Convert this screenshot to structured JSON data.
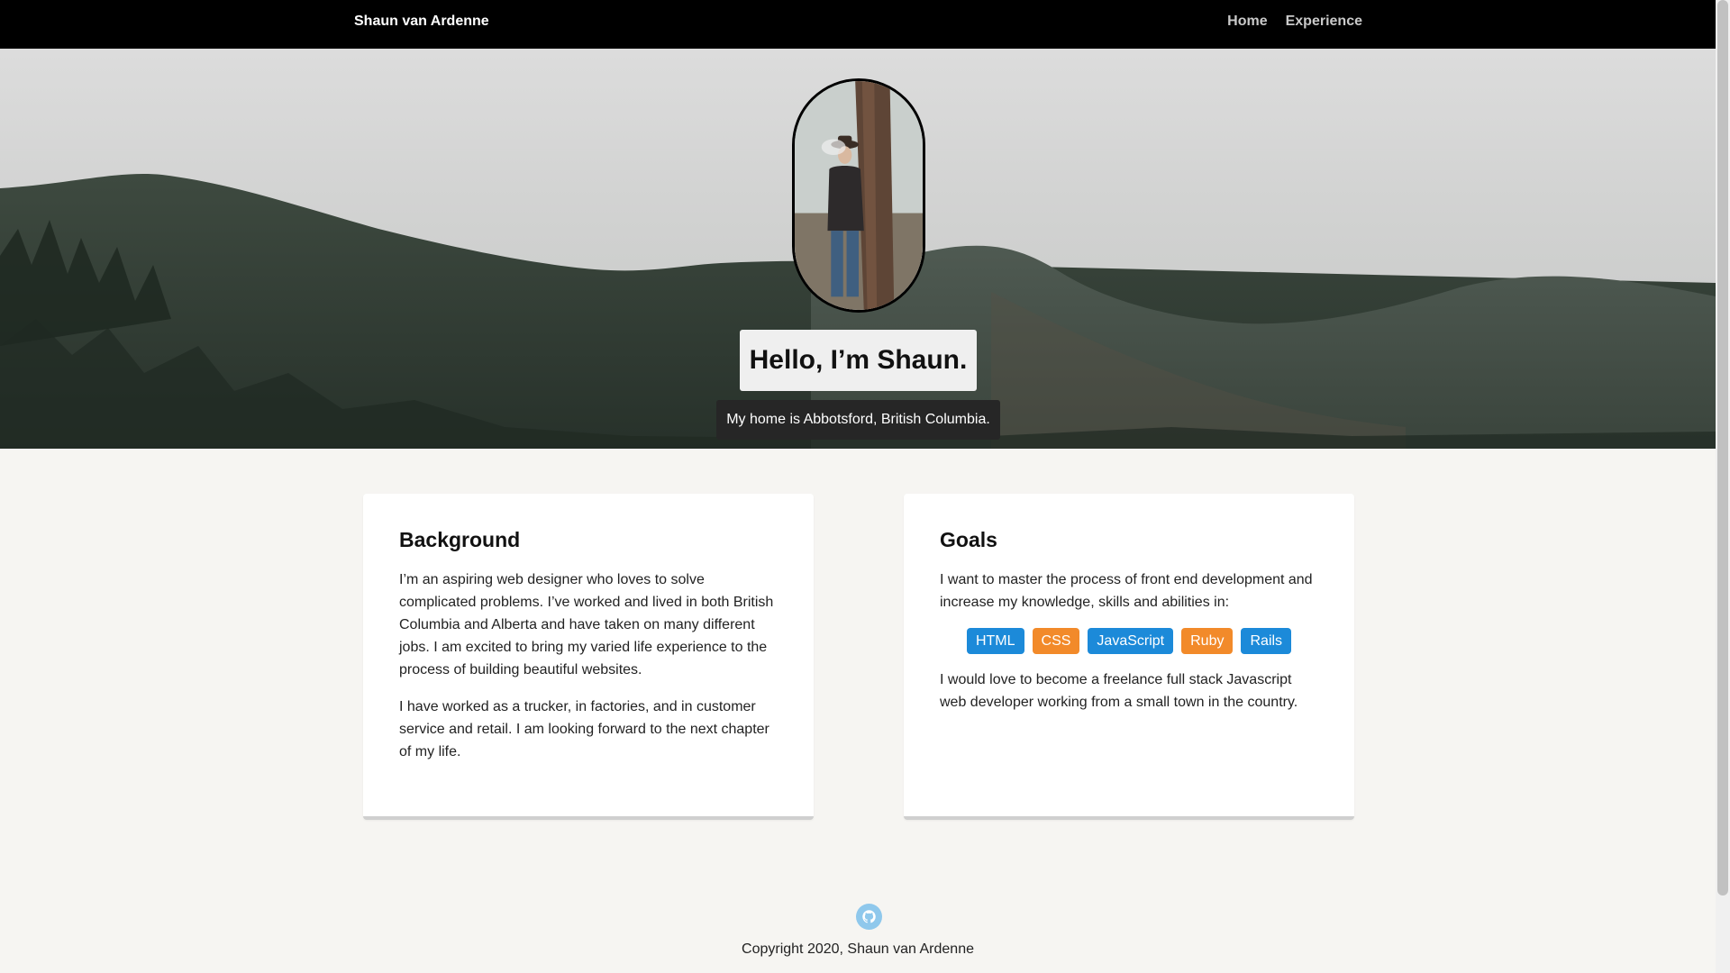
{
  "nav": {
    "brand": "Shaun van Ardenne",
    "links": [
      "Home",
      "Experience"
    ]
  },
  "hero": {
    "heading": "Hello, I’m Shaun.",
    "subheading": "My home is Abbotsford, British Columbia."
  },
  "background_card": {
    "title": "Background",
    "paragraphs": [
      "I’m an aspiring web designer who loves to solve complicated problems. I’ve worked and lived in both British Columbia and Alberta and have taken on many different jobs. I am excited to bring my varied life experience to the process of building beautiful websites.",
      "I have worked as a trucker, in factories, and in customer service and retail. I am looking forward to the next chapter of my life."
    ]
  },
  "goals_card": {
    "title": "Goals",
    "intro": "I want to master the process of front end development and increase my knowledge, skills and abilities in:",
    "tags": [
      "HTML",
      "CSS",
      "JavaScript",
      "Ruby",
      "Rails"
    ],
    "outro": "I would love to become a freelance full stack Javascript web developer working from a small town in the country."
  },
  "footer": {
    "icon": "github-icon",
    "copyright": "Copyright 2020, Shaun van Ardenne"
  },
  "colors": {
    "navbar": "#000000",
    "page_bg": "#f6f5f2",
    "tag_blue": "#1c8ad9",
    "tag_orange": "#f28a2a"
  }
}
